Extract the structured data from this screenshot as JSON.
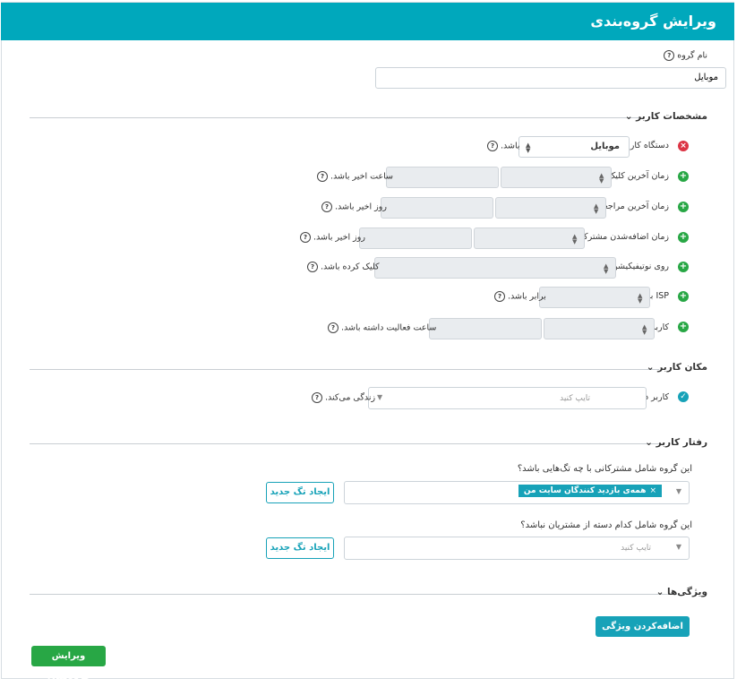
{
  "header": {
    "title": "ویرایش گروه‌بندی"
  },
  "group_name": {
    "label": "نام گروه",
    "value": "موبایل"
  },
  "sections": {
    "user_specs": "مشخصات کاربر",
    "user_location": "مکان کاربر",
    "user_behavior": "رفتار کاربر",
    "features": "ویژگی‌ها"
  },
  "specs": {
    "device": {
      "prefix": "دستگاه کاربر",
      "value": "موبایل",
      "suffix": "باشد."
    },
    "last_click": {
      "prefix": "زمان آخرین کلیک",
      "suffix": "ساعت اخیر باشد."
    },
    "last_visit": {
      "prefix": "زمان آخرین مراجعه",
      "suffix": "روز اخیر باشد."
    },
    "subscribe_time": {
      "prefix": "زمان اضافه‌شدن مشترکین",
      "suffix": "روز اخیر باشد."
    },
    "notification": {
      "prefix": "روی نوتیفیکیشن",
      "suffix": "کلیک کرده باشد."
    },
    "isp": {
      "prefix": "ISP با",
      "suffix": "برابر باشد."
    },
    "activity": {
      "prefix": "کاربر",
      "suffix": "ساعت فعالیت داشته باشد."
    }
  },
  "location": {
    "prefix": "کاربر در",
    "placeholder": "تایپ کنید",
    "suffix": "زندگی می‌کند."
  },
  "behavior": {
    "include_q": "این گروه شامل مشترکانی با چه تگ‌هایی باشد؟",
    "include_tag": "همه‌ی بازدید کنندگان سایت من",
    "exclude_q": "این گروه شامل کدام دسته از مشتریان نباشد؟",
    "exclude_placeholder": "تایپ کنید",
    "new_tag_button": "ایجاد تگ جدید"
  },
  "features": {
    "add_button": "اضافه‌کردن ویژگی جدید"
  },
  "footer": {
    "submit_button": "ویرایش گروه‌بندی"
  },
  "colors": {
    "header": "#00a8bc",
    "add_icon": "#28a745",
    "remove_icon": "#dc3545",
    "teal": "#17a2b8"
  }
}
